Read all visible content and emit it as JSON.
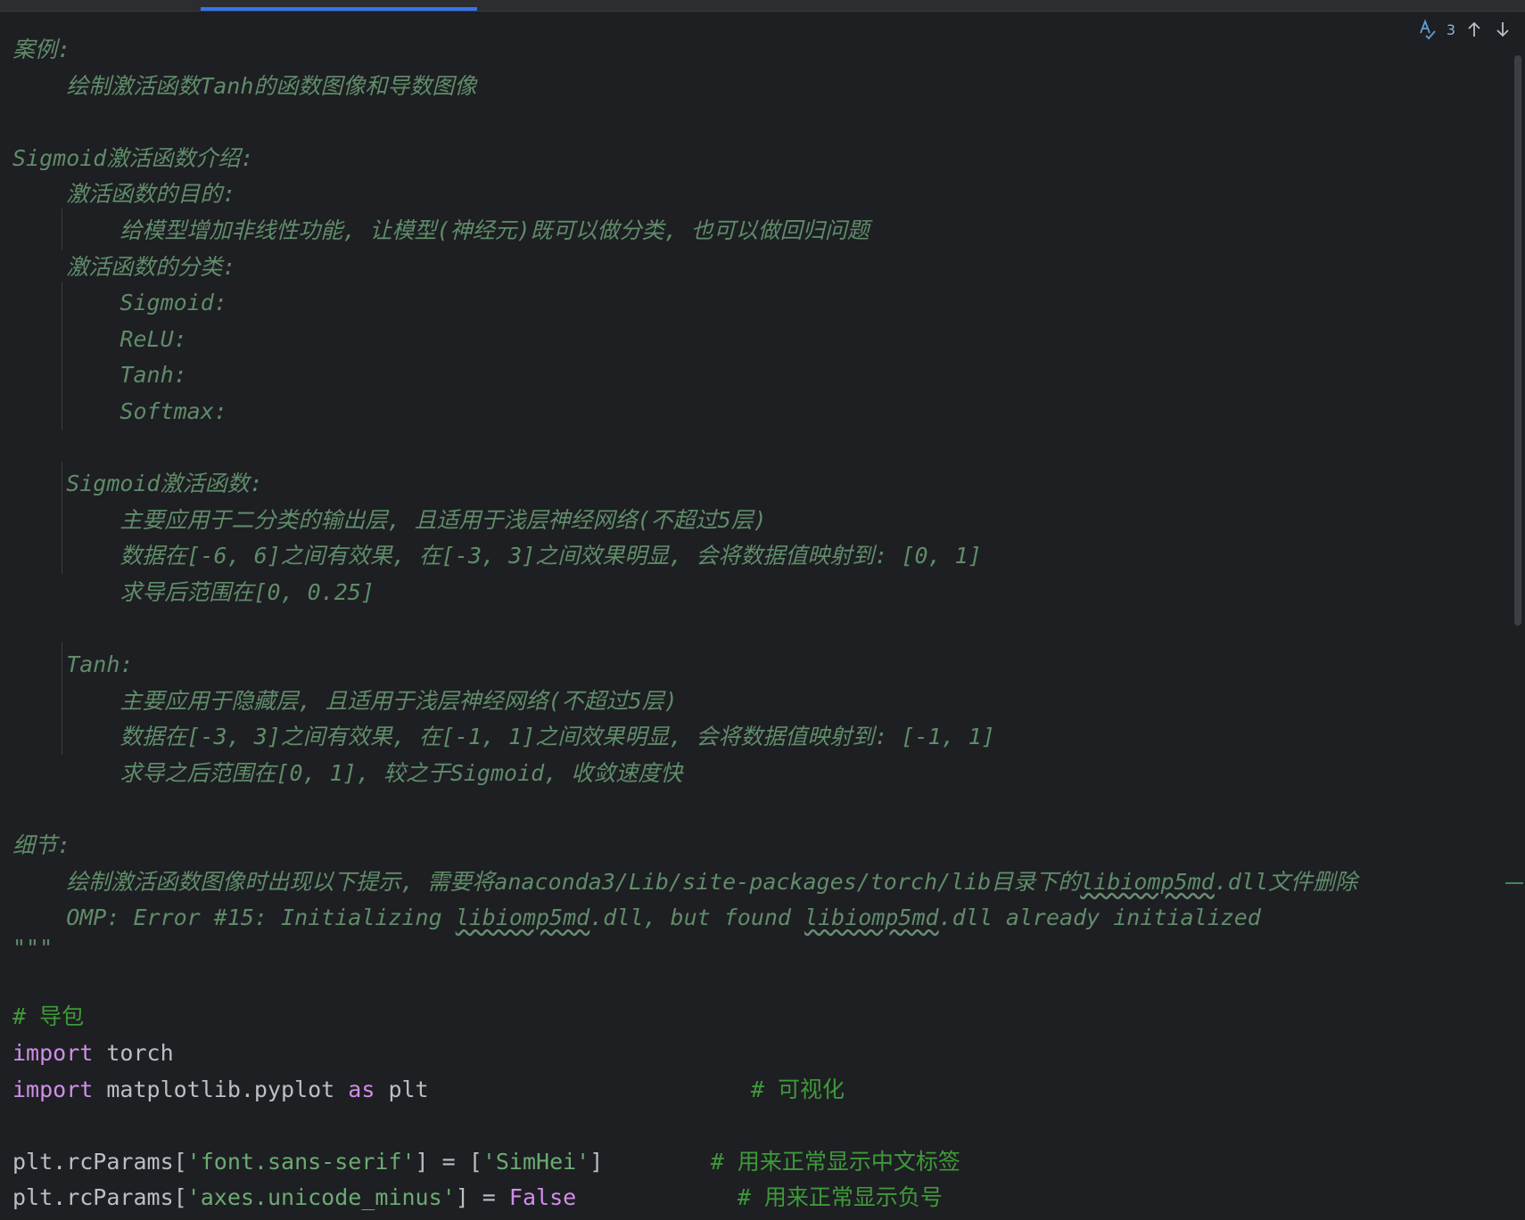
{
  "search_widget": {
    "count": "3"
  },
  "docstring": {
    "lines": [
      "案例:",
      "    绘制激活函数Tanh的函数图像和导数图像",
      "",
      "Sigmoid激活函数介绍:",
      "    激活函数的目的:",
      "        给模型增加非线性功能, 让模型(神经元)既可以做分类, 也可以做回归问题",
      "    激活函数的分类:",
      "        Sigmoid:",
      "        ReLU:",
      "        Tanh:",
      "        Softmax:",
      "",
      "    Sigmoid激活函数:",
      "        主要应用于二分类的输出层, 且适用于浅层神经网络(不超过5层)",
      "        数据在[-6, 6]之间有效果, 在[-3, 3]之间效果明显, 会将数据值映射到: [0, 1]",
      "        求导后范围在[0, 0.25]",
      "",
      "    Tanh:",
      "        主要应用于隐藏层, 且适用于浅层神经网络(不超过5层)",
      "        数据在[-3, 3]之间有效果, 在[-1, 1]之间效果明显, 会将数据值映射到: [-1, 1]",
      "        求导之后范围在[0, 1], 较之于Sigmoid, 收敛速度快",
      "",
      "细节:"
    ],
    "detail_line_1": {
      "prefix": "    绘制激活函数图像时出现以下提示, 需要将anaconda3/Lib/site-packages/torch/lib目录下的",
      "flagged": "libiomp5md",
      "suffix": ".dll文件删除"
    },
    "detail_line_2": {
      "a": "    OMP: Error #15: Initializing ",
      "flagged_1": "libiomp5md",
      "b": ".dll, but found ",
      "flagged_2": "libiomp5md",
      "c": ".dll already initialized"
    },
    "closing": "\"\"\""
  },
  "code": {
    "comment_import": "# 导包",
    "import1": {
      "kw": "import",
      "rest": " torch"
    },
    "import2": {
      "kw": "import",
      "mid": " matplotlib.pyplot ",
      "as": "as",
      "rest": " plt",
      "pad": "                        ",
      "comment": "# 可视化"
    },
    "rc1": {
      "a": "plt.rcParams[",
      "s1": "'font.sans-serif'",
      "b": "] = [",
      "s2": "'SimHei'",
      "c": "]",
      "pad": "        ",
      "comment": "# 用来正常显示中文标签"
    },
    "rc2": {
      "a": "plt.rcParams[",
      "s1": "'axes.unicode_minus'",
      "b": "] = ",
      "kw": "False",
      "pad": "            ",
      "comment": "# 用来正常显示负号"
    }
  },
  "colors": {
    "background": "#1e1f22",
    "docstring": "#5f8c6a",
    "keyword": "#cf8ee8",
    "string": "#6aab73",
    "comment": "#3e9a3a",
    "text": "#bcbec4",
    "accent": "#3574f0"
  },
  "icons": [
    "spellcheck-icon",
    "arrow-up-icon",
    "arrow-down-icon"
  ]
}
